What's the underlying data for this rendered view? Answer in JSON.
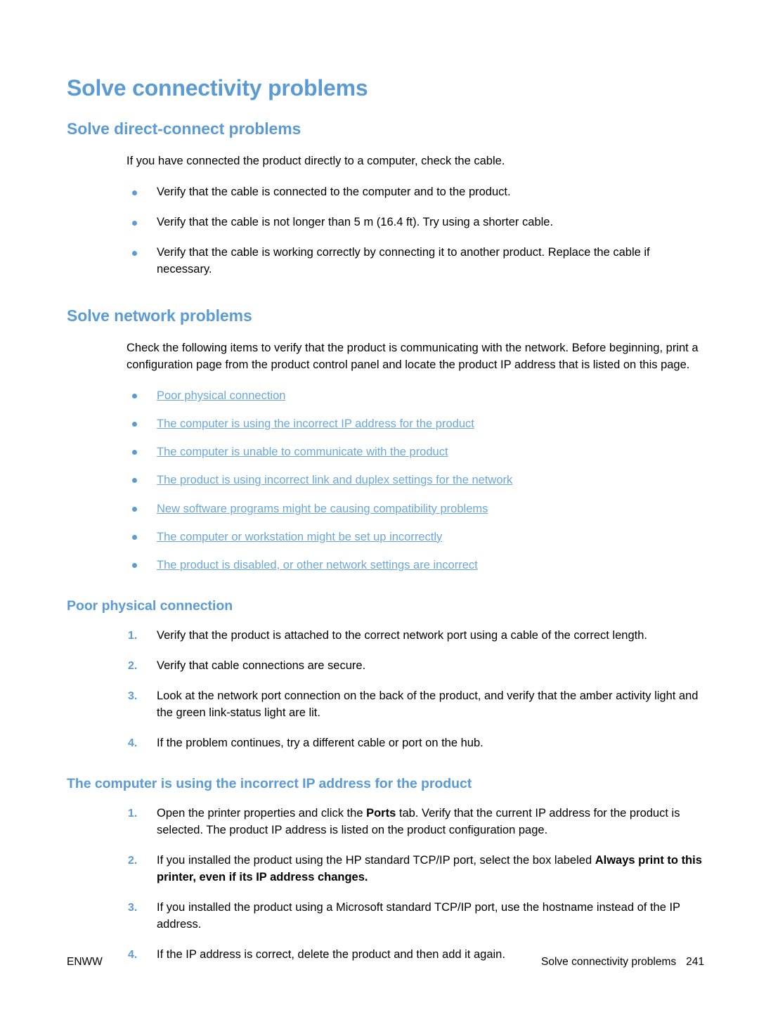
{
  "page": {
    "title": "Solve connectivity problems",
    "footer_left": "ENWW",
    "footer_right_title": "Solve connectivity problems",
    "footer_page_number": "241",
    "accent_color": "#5b9bd5",
    "link_color": "#6aa7db",
    "text_color": "#000000"
  },
  "sections": {
    "direct_connect": {
      "heading": "Solve direct-connect problems",
      "intro": "If you have connected the product directly to a computer, check the cable.",
      "bullets": [
        "Verify that the cable is connected to the computer and to the product.",
        "Verify that the cable is not longer than 5 m (16.4 ft). Try using a shorter cable.",
        "Verify that the cable is working correctly by connecting it to another product. Replace the cable if necessary."
      ]
    },
    "network": {
      "heading": "Solve network problems",
      "intro": "Check the following items to verify that the product is communicating with the network. Before beginning, print a configuration page from the product control panel and locate the product IP address that is listed on this page.",
      "links": [
        "Poor physical connection",
        "The computer is using the incorrect IP address for the product",
        "The computer is unable to communicate with the product",
        "The product is using incorrect link and duplex settings for the network",
        "New software programs might be causing compatibility problems",
        "The computer or workstation might be set up incorrectly",
        "The product is disabled, or other network settings are incorrect"
      ]
    },
    "poor_physical": {
      "heading": "Poor physical connection",
      "steps": [
        {
          "num": "1.",
          "text": "Verify that the product is attached to the correct network port using a cable of the correct length."
        },
        {
          "num": "2.",
          "text": "Verify that cable connections are secure."
        },
        {
          "num": "3.",
          "text": "Look at the network port connection on the back of the product, and verify that the amber activity light and the green link-status light are lit."
        },
        {
          "num": "4.",
          "text": "If the problem continues, try a different cable or port on the hub."
        }
      ]
    },
    "incorrect_ip": {
      "heading": "The computer is using the incorrect IP address for the product",
      "steps": [
        {
          "num": "1.",
          "parts": [
            {
              "t": "Open the printer properties and click the ",
              "b": false
            },
            {
              "t": "Ports",
              "b": true
            },
            {
              "t": " tab. Verify that the current IP address for the product is selected. The product IP address is listed on the product configuration page.",
              "b": false
            }
          ]
        },
        {
          "num": "2.",
          "parts": [
            {
              "t": "If you installed the product using the HP standard TCP/IP port, select the box labeled ",
              "b": false
            },
            {
              "t": "Always print to this printer, even if its IP address changes.",
              "b": true
            }
          ]
        },
        {
          "num": "3.",
          "parts": [
            {
              "t": "If you installed the product using a Microsoft standard TCP/IP port, use the hostname instead of the IP address.",
              "b": false
            }
          ]
        },
        {
          "num": "4.",
          "parts": [
            {
              "t": "If the IP address is correct, delete the product and then add it again.",
              "b": false
            }
          ]
        }
      ]
    }
  }
}
